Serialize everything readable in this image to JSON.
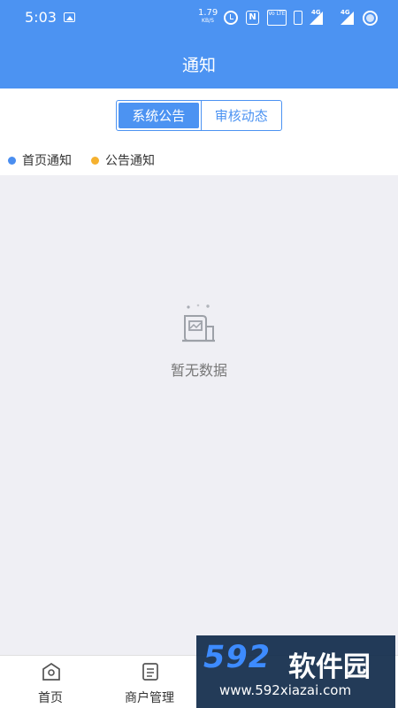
{
  "status": {
    "time": "5:03",
    "net_speed": "1.79",
    "net_unit": "KB/S",
    "volte_label": "Vo LTE",
    "network_1": "4G",
    "network_2": "4G",
    "nfc_label": "N"
  },
  "header": {
    "title": "通知"
  },
  "segments": {
    "system": "系统公告",
    "review": "审核动态"
  },
  "legend": {
    "home_notice": "首页通知",
    "announcement_notice": "公告通知",
    "colors": {
      "home": "#4a8ef0",
      "announcement": "#f5b12f"
    }
  },
  "empty": {
    "message": "暂无数据"
  },
  "tabbar": {
    "home": "首页",
    "merchant": "商户管理",
    "me": ""
  },
  "watermark": {
    "logo": "592",
    "name": "软件园",
    "url": "www.592xiazai.com"
  },
  "colors": {
    "primary": "#4c93f2",
    "background": "#efeff4"
  }
}
